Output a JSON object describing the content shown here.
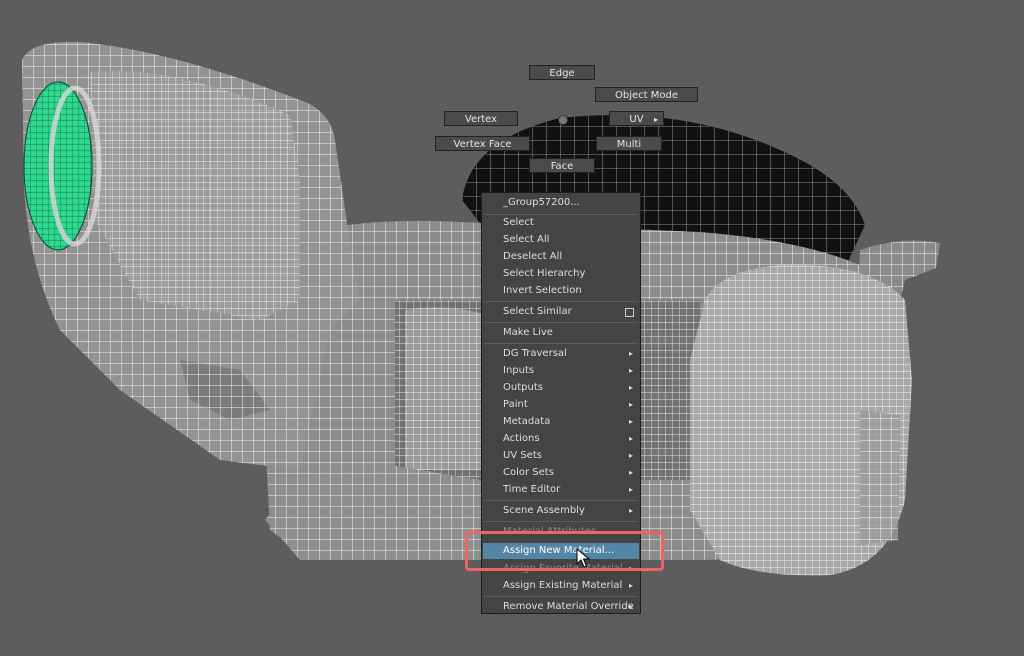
{
  "marking_menu": {
    "edge": "Edge",
    "object_mode": "Object Mode",
    "vertex": "Vertex",
    "uv": "UV",
    "vertex_face": "Vertex Face",
    "multi": "Multi",
    "face": "Face"
  },
  "context_menu": {
    "header": "_Group57200...",
    "items": [
      {
        "label": "Select"
      },
      {
        "label": "Select All"
      },
      {
        "label": "Deselect All"
      },
      {
        "label": "Select Hierarchy"
      },
      {
        "label": "Invert Selection"
      },
      {
        "label": "Select Similar"
      },
      {
        "label": "Make Live"
      },
      {
        "label": "DG Traversal"
      },
      {
        "label": "Inputs"
      },
      {
        "label": "Outputs"
      },
      {
        "label": "Paint"
      },
      {
        "label": "Metadata"
      },
      {
        "label": "Actions"
      },
      {
        "label": "UV Sets"
      },
      {
        "label": "Color Sets"
      },
      {
        "label": "Time Editor"
      },
      {
        "label": "Scene Assembly"
      },
      {
        "label": "Material Attributes..."
      },
      {
        "label": "Assign New Material..."
      },
      {
        "label": "Assign Favorite Material"
      },
      {
        "label": "Assign Existing Material"
      },
      {
        "label": "Remove Material Override"
      }
    ]
  },
  "colors": {
    "viewport_bg": "#5d5d5d",
    "mesh_fill": "#909090",
    "mesh_wire": "#f2f2f2",
    "selected_face": "#2fd88f",
    "menu_bg": "#444444",
    "menu_highlight": "#5285a6",
    "annotation": "#ea6468"
  }
}
